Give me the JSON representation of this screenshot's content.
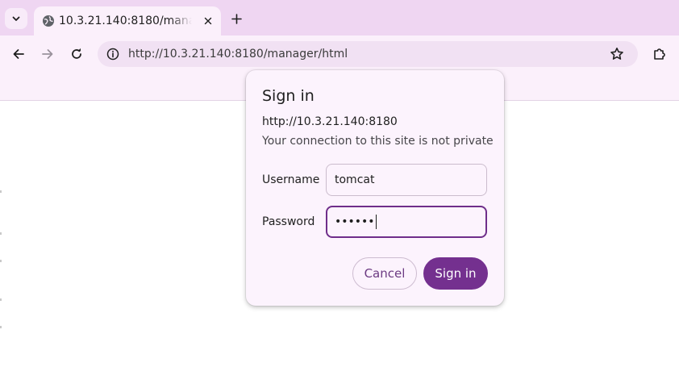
{
  "browser": {
    "tab": {
      "title": "10.3.21.140:8180/manager/html",
      "favicon": "globe-icon"
    },
    "address_bar": {
      "url": "http://10.3.21.140:8180/manager/html"
    },
    "icons": {
      "tab_search": "chevron-down-icon",
      "close_tab": "close-icon",
      "new_tab": "plus-icon",
      "back": "arrow-left-icon",
      "forward": "arrow-right-icon",
      "reload": "reload-icon",
      "site_info": "info-icon",
      "bookmark": "star-icon",
      "extensions": "puzzle-icon"
    },
    "colors": {
      "tabstrip": "#efd6f2",
      "toolbar": "#fbf0fb",
      "accent": "#74308f"
    }
  },
  "dialog": {
    "title": "Sign in",
    "origin": "http://10.3.21.140:8180",
    "warning": "Your connection to this site is not private",
    "username_label": "Username",
    "username_value": "tomcat",
    "password_label": "Password",
    "password_masked": "••••••",
    "cancel_label": "Cancel",
    "signin_label": "Sign in"
  }
}
